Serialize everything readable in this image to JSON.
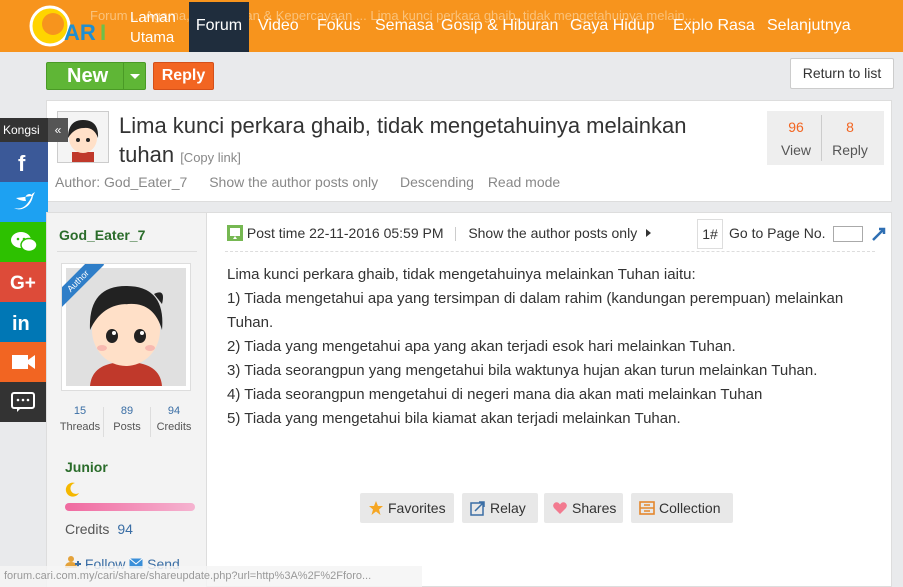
{
  "nav": {
    "logo_text": "CARI",
    "breadcrumb": "Forum ... Agama, Kerohanian & Kepercayaan ... Lima kunci perkara ghaib, tidak mengetahuinya melain...",
    "home": "Laman Utama",
    "items": [
      "Forum",
      "Video",
      "Fokus",
      "Semasa",
      "Gosip & Hiburan",
      "Gaya Hidup",
      "Explo Rasa",
      "Selanjutnya"
    ]
  },
  "toolbar": {
    "new_label": "New",
    "reply_label": "Reply",
    "return_label": "Return to list"
  },
  "thread": {
    "title": "Lima kunci perkara ghaib, tidak mengetahuinya melainkan tuhan",
    "copy_link": "[Copy link]",
    "author_line": "Author: God_Eater_7",
    "show_author": "Show the author posts only",
    "descending": "Descending",
    "read_mode": "Read mode",
    "views": "96",
    "views_label": "View",
    "replies": "8",
    "replies_label": "Reply"
  },
  "share": {
    "label": "Kongsi",
    "collapse": "«",
    "buttons": [
      {
        "icon": "facebook-icon",
        "color": "#3b5998"
      },
      {
        "icon": "twitter-icon",
        "color": "#1da1f2"
      },
      {
        "icon": "wechat-icon",
        "color": "#2dc100"
      },
      {
        "icon": "google-plus-icon",
        "color": "#dd4b39"
      },
      {
        "icon": "linkedin-icon",
        "color": "#0077b5"
      },
      {
        "icon": "video-icon",
        "color": "#f26522"
      },
      {
        "icon": "comment-icon",
        "color": "#333333"
      }
    ]
  },
  "user": {
    "name": "God_Eater_7",
    "badge": "Author",
    "threads": "15",
    "threads_label": "Threads",
    "posts": "89",
    "posts_label": "Posts",
    "credits": "94",
    "credits_label": "Credits",
    "rank": "Junior",
    "credits_line_label": "Credits",
    "follow": "Follow",
    "send": "Send"
  },
  "post": {
    "time": "Post time 22-11-2016 05:59 PM",
    "show_author": "Show the author posts only",
    "floor": "1#",
    "goto_label": "Go to Page No.",
    "lines": [
      "Lima kunci perkara ghaib, tidak mengetahuinya melainkan Tuhan iaitu:",
      "1) Tiada mengetahui apa yang tersimpan di dalam rahim (kandungan perempuan) melainkan Tuhan.",
      "2) Tiada yang mengetahui apa yang akan terjadi esok hari melainkan Tuhan.",
      "3) Tiada seorangpun yang mengetahui bila waktunya hujan akan turun melainkan Tuhan.",
      "4) Tiada seorangpun mengetahui di negeri mana dia akan mati melainkan Tuhan",
      "5) Tiada yang mengetahui bila kiamat akan terjadi melainkan Tuhan."
    ],
    "actions": [
      "Favorites",
      "Relay",
      "Shares",
      "Collection"
    ]
  },
  "status_url": "forum.cari.com.my/cari/share/shareupdate.php?url=http%3A%2F%2Fforo..."
}
